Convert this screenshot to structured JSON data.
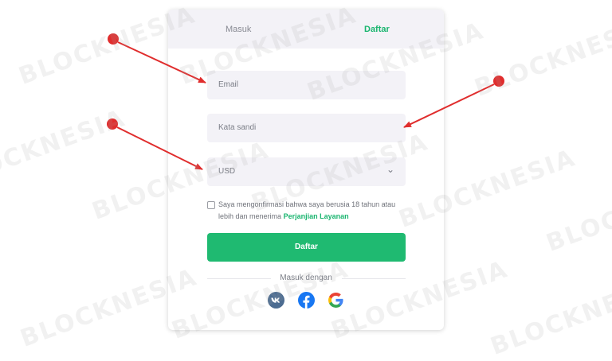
{
  "watermark": {
    "text": "BLOCKNESIA"
  },
  "tabs": [
    {
      "label": "Masuk",
      "active": false
    },
    {
      "label": "Daftar",
      "active": true
    }
  ],
  "form": {
    "email_placeholder": "Email",
    "password_placeholder": "Kata sandi",
    "currency": {
      "selected": "USD"
    },
    "consent": {
      "text": "Saya mengonfirmasi bahwa saya berusia 18 tahun atau lebih dan menerima",
      "link": "Perjanjian Layanan",
      "checked": false
    },
    "submit_label": "Daftar"
  },
  "social": {
    "heading": "Masuk dengan",
    "icons": [
      "vk-icon",
      "facebook-icon",
      "google-icon"
    ]
  },
  "colors": {
    "accent": "#1fba71",
    "annotation": "#e02d2d",
    "field_bg": "#f3f2f7"
  }
}
